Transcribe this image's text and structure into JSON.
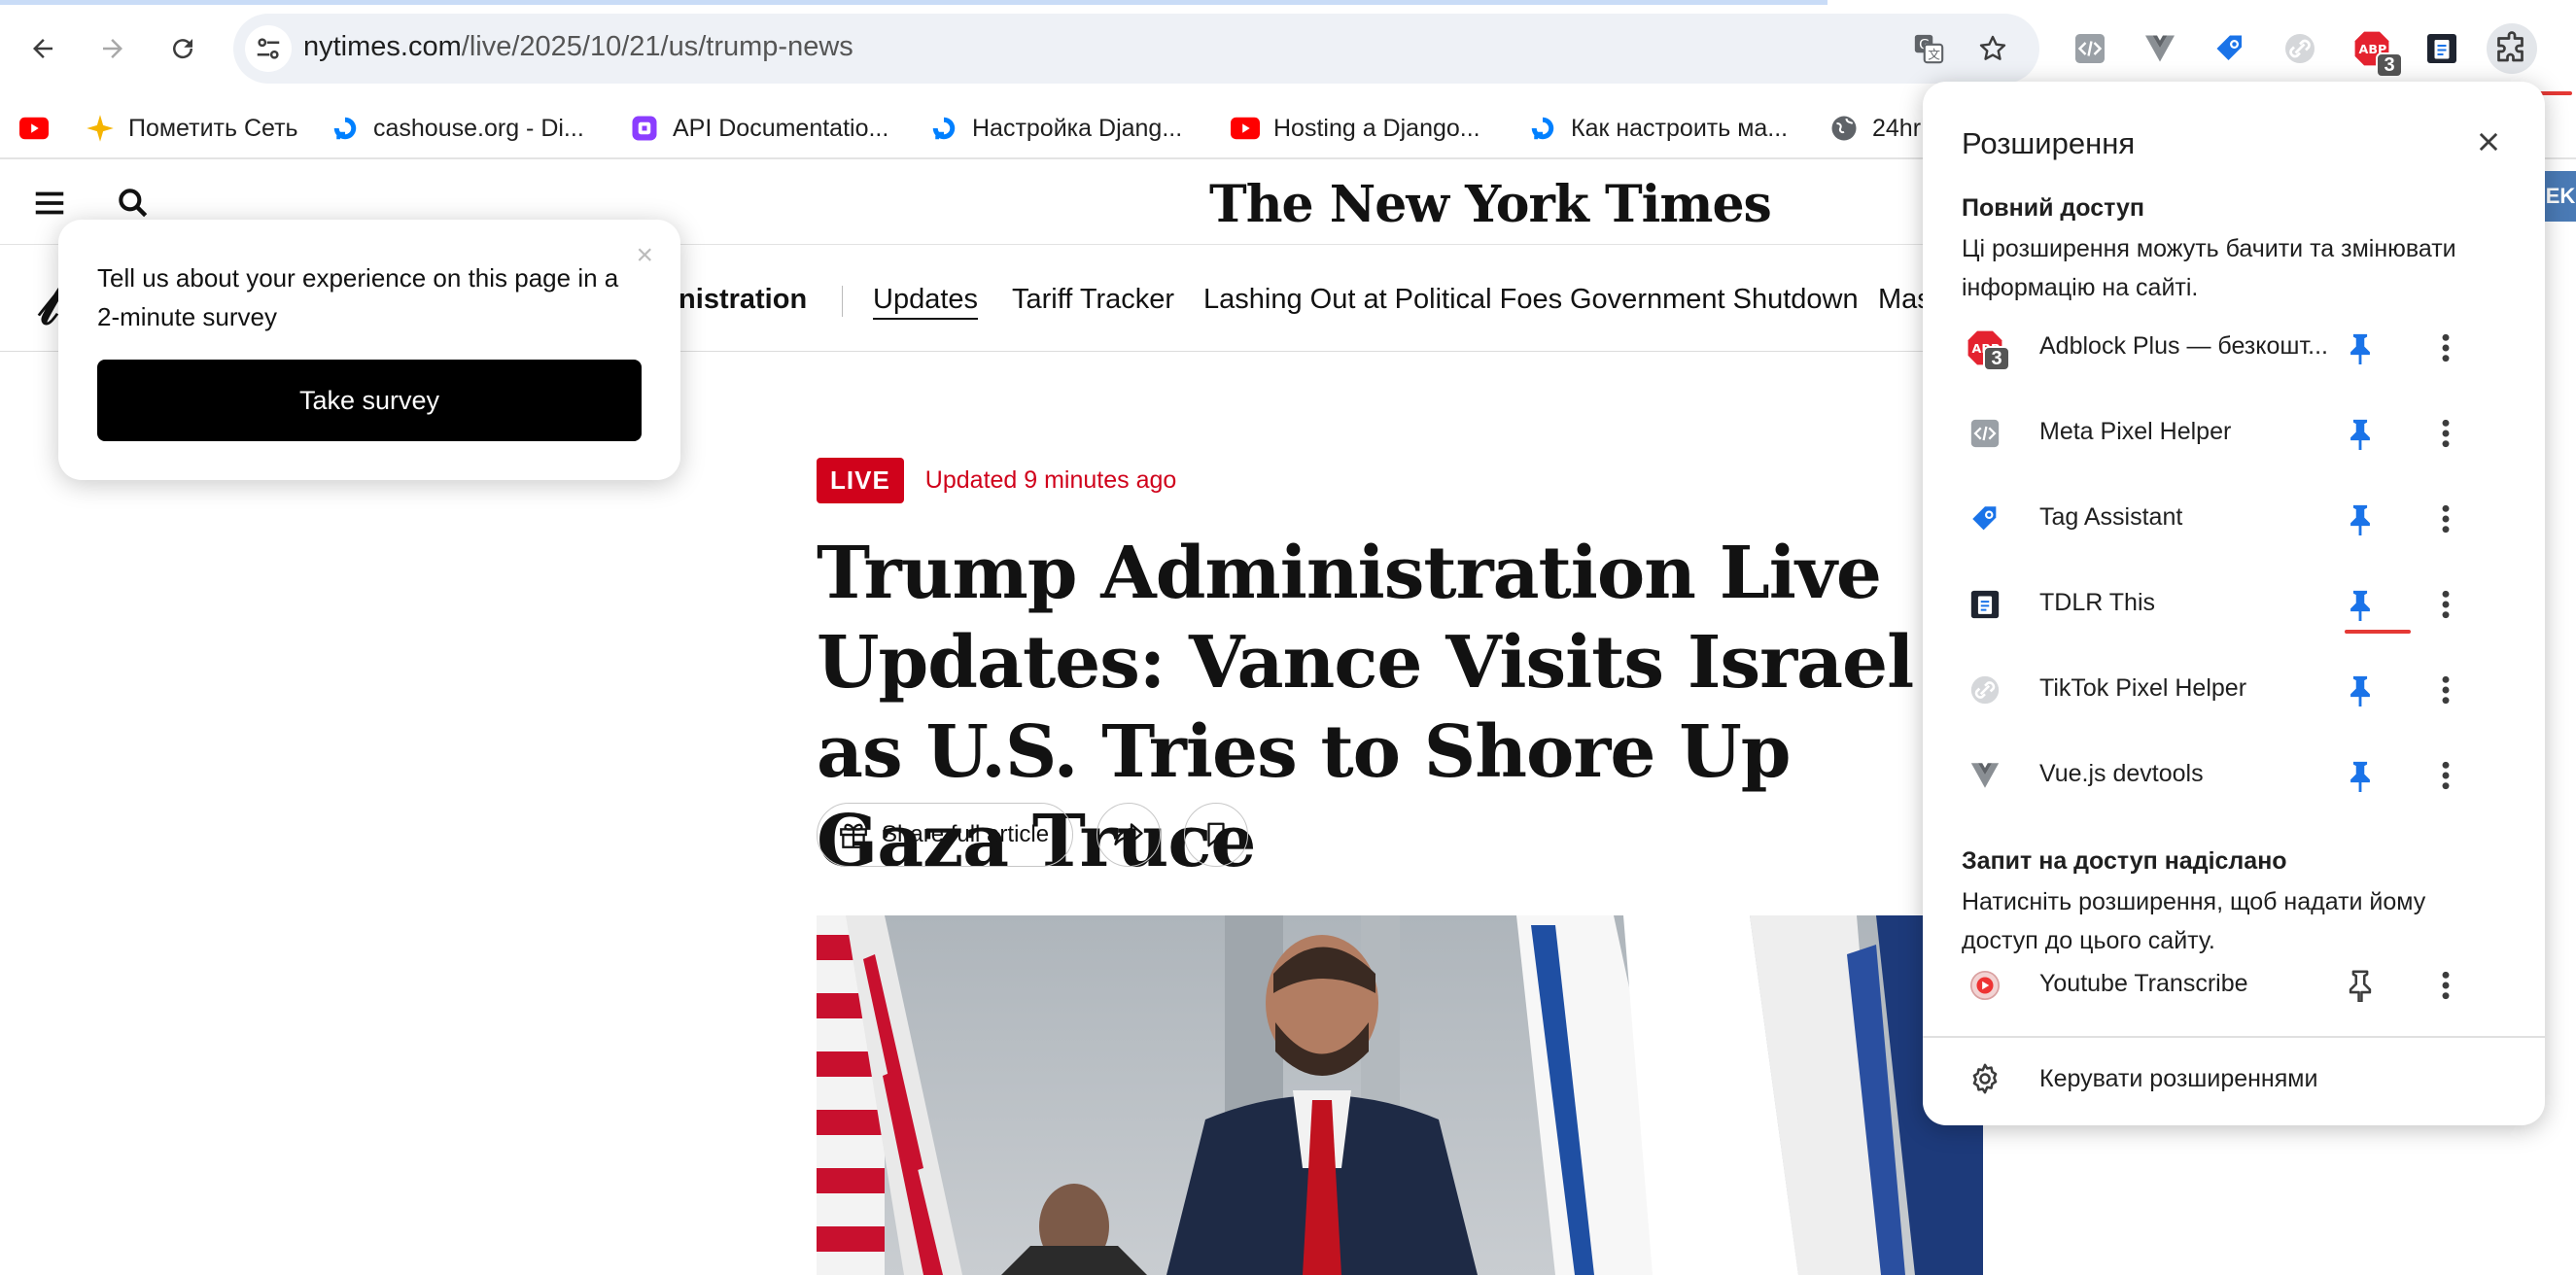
{
  "browser": {
    "url_host": "nytimes.com",
    "url_path": "/live/2025/10/21/us/trump-news",
    "extension_badge_count": "3"
  },
  "bookmarks": [
    {
      "label": "",
      "icon": "youtube-icon"
    },
    {
      "label": "Пометить Сеть",
      "icon": "sparkle-icon"
    },
    {
      "label": "cashouse.org - Di...",
      "icon": "digitalocean-icon"
    },
    {
      "label": "API Documentatio...",
      "icon": "app-icon"
    },
    {
      "label": "Настройка Djang...",
      "icon": "digitalocean-icon"
    },
    {
      "label": "Hosting a Django...",
      "icon": "youtube-icon"
    },
    {
      "label": "Как настроить ма...",
      "icon": "digitalocean-icon"
    },
    {
      "label": "24hr",
      "icon": "globe-icon"
    }
  ],
  "survey": {
    "text": "Tell us about your experience on this page in a 2-minute survey",
    "close": "×",
    "button": "Take survey"
  },
  "nyt": {
    "logo": "The New York Times",
    "subnav": [
      "inistration",
      "Updates",
      "Tariff Tracker",
      "Lashing Out at Political Foes",
      "Government Shutdown",
      "Mas"
    ],
    "live_label": "LIVE",
    "updated": "Updated 9 minutes ago",
    "headline": "Trump Administration Live Updates: Vance Visits Israel as U.S. Tries to Shore Up Gaza Truce",
    "share_label": "Share full article"
  },
  "extensions_popup": {
    "title": "Розширення",
    "full_access_title": "Повний доступ",
    "full_access_desc": "Ці розширення можуть бачити та змінювати інформацію на сайті.",
    "full_access_items": [
      {
        "name": "Adblock Plus — безкошт...",
        "icon": "adblock-icon",
        "pinned": true
      },
      {
        "name": "Meta Pixel Helper",
        "icon": "code-icon",
        "pinned": true
      },
      {
        "name": "Tag Assistant",
        "icon": "tag-assistant-icon",
        "pinned": true
      },
      {
        "name": "TDLR This",
        "icon": "tdlr-icon",
        "pinned": true
      },
      {
        "name": "TikTok Pixel Helper",
        "icon": "link-icon",
        "pinned": true
      },
      {
        "name": "Vue.js devtools",
        "icon": "vue-icon",
        "pinned": true
      }
    ],
    "request_title": "Запит на доступ надіслано",
    "request_desc": "Натисніть розширення, щоб надати йому доступ до цього сайту.",
    "request_items": [
      {
        "name": "Youtube Transcribe",
        "icon": "youtube-transcribe-icon",
        "pinned": false
      }
    ],
    "manage_label": "Керувати розширеннями"
  },
  "colors": {
    "pin_blue": "#1a73e8",
    "nyt_red": "#d0021b",
    "highlight_red": "#e53935"
  },
  "right_edge_text": "EK"
}
